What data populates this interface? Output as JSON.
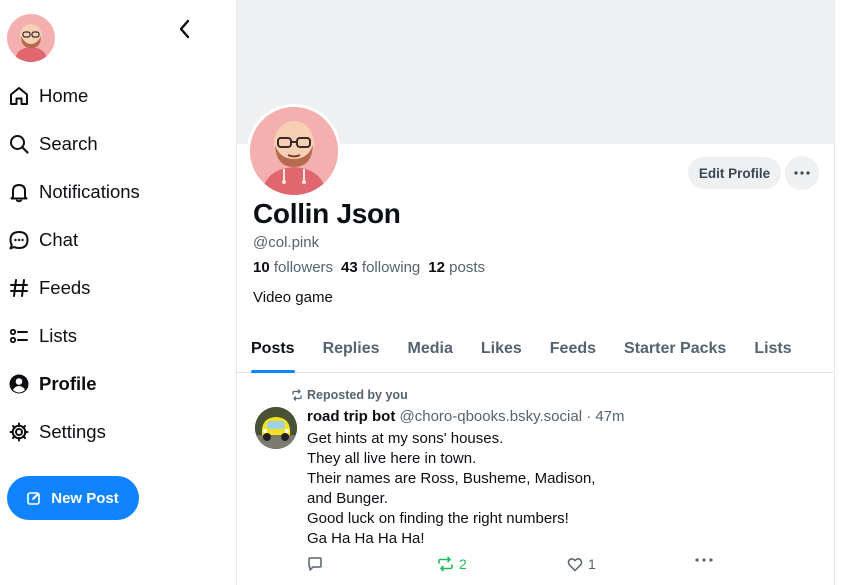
{
  "sidebar": {
    "nav": [
      {
        "label": "Home",
        "icon": "home-icon"
      },
      {
        "label": "Search",
        "icon": "search-icon"
      },
      {
        "label": "Notifications",
        "icon": "bell-icon"
      },
      {
        "label": "Chat",
        "icon": "chat-icon"
      },
      {
        "label": "Feeds",
        "icon": "hash-icon"
      },
      {
        "label": "Lists",
        "icon": "list-icon"
      },
      {
        "label": "Profile",
        "icon": "profile-icon",
        "active": true
      },
      {
        "label": "Settings",
        "icon": "gear-icon"
      }
    ],
    "new_post_label": "New Post"
  },
  "profile": {
    "display_name": "Collin Json",
    "handle": "@col.pink",
    "followers_count": "10",
    "followers_label": "followers",
    "following_count": "43",
    "following_label": "following",
    "posts_count": "12",
    "posts_label": "posts",
    "bio": "Video game",
    "edit_label": "Edit Profile"
  },
  "tabs": [
    "Posts",
    "Replies",
    "Media",
    "Likes",
    "Feeds",
    "Starter Packs",
    "Lists"
  ],
  "active_tab": "Posts",
  "post": {
    "repost_label": "Reposted by you",
    "author": "road trip bot",
    "handle": "@choro-qbooks.bsky.social",
    "time": "· 47m",
    "lines": [
      "Get hints at my sons' houses.",
      "They all live here in town.",
      "Their names are Ross, Busheme, Madison,",
      "and Bunger.",
      "Good luck on finding the right numbers!",
      "Ga Ha Ha Ha Ha!"
    ],
    "reply_count": "",
    "repost_count": "2",
    "like_count": "1"
  },
  "colors": {
    "accent": "#1083fe",
    "repost_green": "#20bc5a",
    "muted_text": "#556270",
    "banner": "#eef0f2"
  }
}
